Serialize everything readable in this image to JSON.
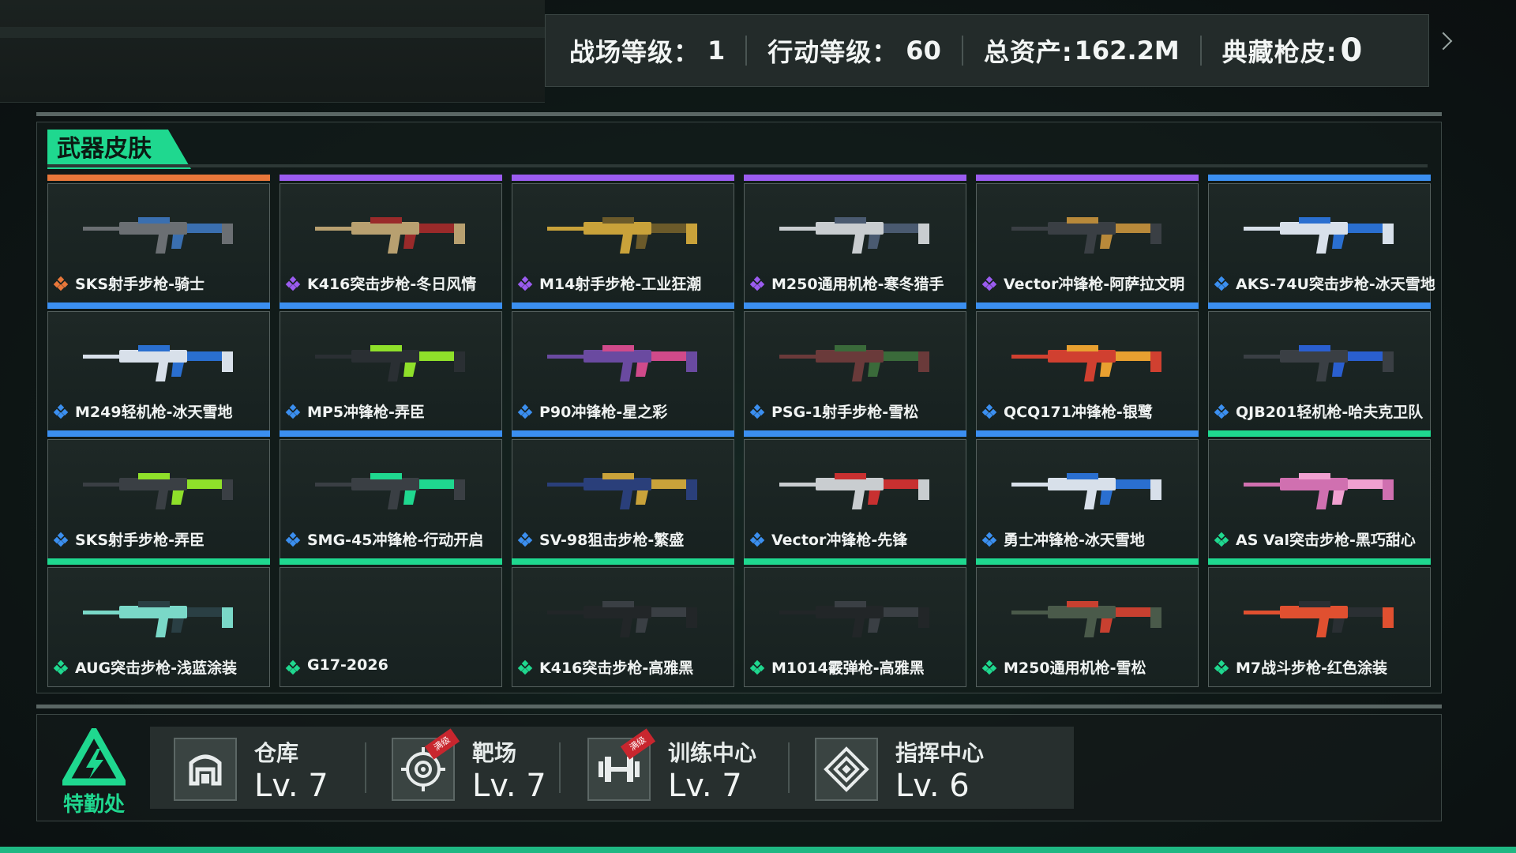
{
  "header": {
    "stats": [
      {
        "label": "战场等级：",
        "value": "1"
      },
      {
        "label": "行动等级：",
        "value": "60"
      },
      {
        "label": "总资产:",
        "value": "162.2M"
      },
      {
        "label": "典藏枪皮:",
        "value": "0"
      }
    ]
  },
  "panel": {
    "title": "武器皮肤",
    "skins": [
      {
        "name": "SKS射手步枪-骑士",
        "rarity": "#e8773a"
      },
      {
        "name": "K416突击步枪-冬日风情",
        "rarity": "#9b5cf0"
      },
      {
        "name": "M14射手步枪-工业狂潮",
        "rarity": "#9b5cf0"
      },
      {
        "name": "M250通用机枪-寒冬猎手",
        "rarity": "#9b5cf0"
      },
      {
        "name": "Vector冲锋枪-阿萨拉文明",
        "rarity": "#9b5cf0"
      },
      {
        "name": "AKS-74U突击步枪-冰天雪地",
        "rarity": "#3b8ff0"
      },
      {
        "name": "M249轻机枪-冰天雪地",
        "rarity": "#3b8ff0"
      },
      {
        "name": "MP5冲锋枪-弄臣",
        "rarity": "#3b8ff0"
      },
      {
        "name": "P90冲锋枪-星之彩",
        "rarity": "#3b8ff0"
      },
      {
        "name": "PSG-1射手步枪-雪松",
        "rarity": "#3b8ff0"
      },
      {
        "name": "QCQ171冲锋枪-银鹭",
        "rarity": "#3b8ff0"
      },
      {
        "name": "QJB201轻机枪-哈夫克卫队",
        "rarity": "#3b8ff0"
      },
      {
        "name": "SKS射手步枪-弄臣",
        "rarity": "#3b8ff0"
      },
      {
        "name": "SMG-45冲锋枪-行动开启",
        "rarity": "#3b8ff0"
      },
      {
        "name": "SV-98狙击步枪-繁盛",
        "rarity": "#3b8ff0"
      },
      {
        "name": "Vector冲锋枪-先锋",
        "rarity": "#3b8ff0"
      },
      {
        "name": "勇士冲锋枪-冰天雪地",
        "rarity": "#3b8ff0"
      },
      {
        "name": "AS Val突击步枪-黑巧甜心",
        "rarity": "#1fd88f"
      },
      {
        "name": "AUG突击步枪-浅蓝涂装",
        "rarity": "#1fd88f"
      },
      {
        "name": "G17-2026",
        "rarity": "#1fd88f"
      },
      {
        "name": "K416突击步枪-高雅黑",
        "rarity": "#1fd88f"
      },
      {
        "name": "M1014霰弹枪-高雅黑",
        "rarity": "#1fd88f"
      },
      {
        "name": "M250通用机枪-雪松",
        "rarity": "#1fd88f"
      },
      {
        "name": "M7战斗步枪-红色涂装",
        "rarity": "#1fd88f"
      }
    ]
  },
  "bottom": {
    "logo_text": "特勤处",
    "facilities": [
      {
        "title": "仓库",
        "level": "Lv. 7",
        "icon": "warehouse-icon",
        "tag": ""
      },
      {
        "title": "靶场",
        "level": "Lv. 7",
        "icon": "target-icon",
        "tag": "满级"
      },
      {
        "title": "训练中心",
        "level": "Lv. 7",
        "icon": "dumbbell-icon",
        "tag": "满级"
      },
      {
        "title": "指挥中心",
        "level": "Lv. 6",
        "icon": "command-icon",
        "tag": ""
      }
    ]
  },
  "colors": {
    "accent": "#1fd88f",
    "legendary": "#e8773a",
    "epic": "#9b5cf0",
    "rare": "#3b8ff0",
    "uncommon": "#1fd88f"
  }
}
